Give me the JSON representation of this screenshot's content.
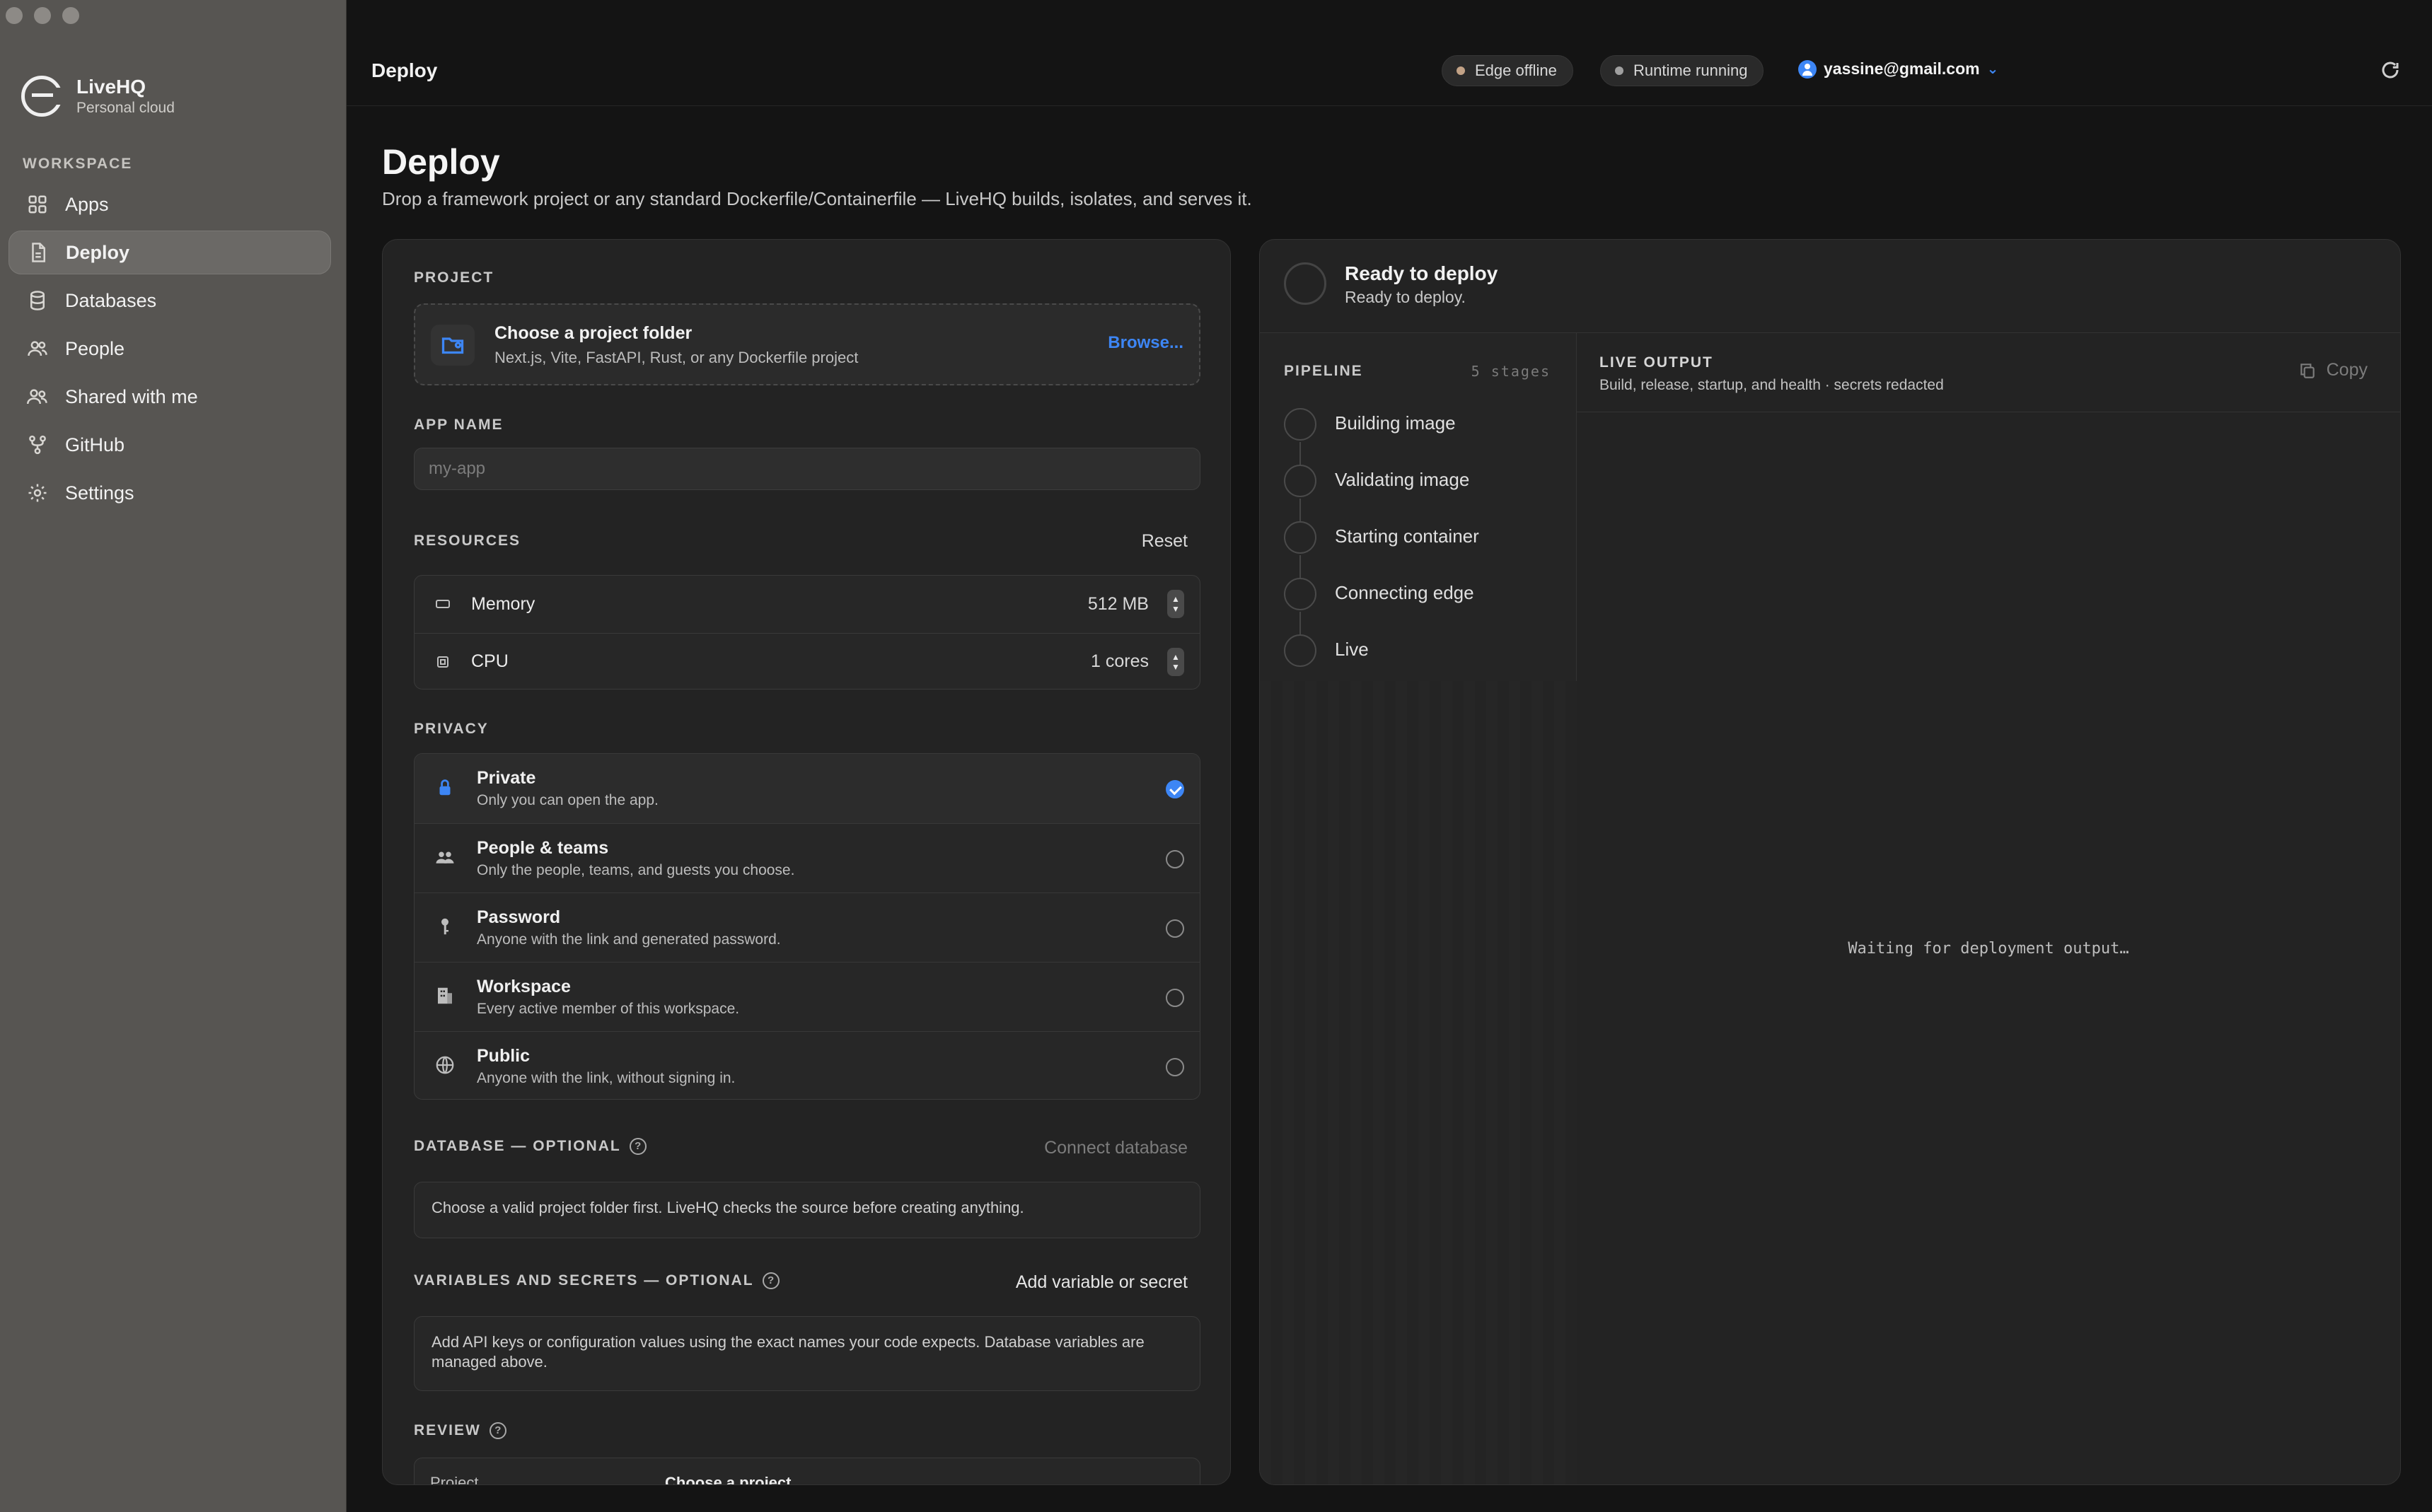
{
  "app": {
    "name": "LiveHQ",
    "subtitle": "Personal cloud"
  },
  "sidebar": {
    "section_label": "WORKSPACE",
    "items": [
      {
        "label": "Apps",
        "icon": "grid-icon"
      },
      {
        "label": "Deploy",
        "icon": "document-icon",
        "active": true
      },
      {
        "label": "Databases",
        "icon": "database-icon"
      },
      {
        "label": "People",
        "icon": "people-icon"
      },
      {
        "label": "Shared with me",
        "icon": "shared-icon"
      },
      {
        "label": "GitHub",
        "icon": "branch-icon"
      },
      {
        "label": "Settings",
        "icon": "gear-icon"
      }
    ]
  },
  "topbar": {
    "title": "Deploy",
    "edge_status": "Edge offline",
    "runtime_status": "Runtime running",
    "user_email": "yassine@gmail.com"
  },
  "page": {
    "title": "Deploy",
    "description": "Drop a framework project or any standard Dockerfile/Containerfile — LiveHQ builds, isolates, and serves it."
  },
  "form": {
    "project": {
      "label": "PROJECT",
      "title": "Choose a project folder",
      "subtitle": "Next.js, Vite, FastAPI, Rust, or any Dockerfile project",
      "browse": "Browse..."
    },
    "app_name": {
      "label": "APP NAME",
      "placeholder": "my-app",
      "value": ""
    },
    "resources": {
      "label": "RESOURCES",
      "reset": "Reset",
      "memory_label": "Memory",
      "memory_value": "512 MB",
      "cpu_label": "CPU",
      "cpu_value": "1 cores"
    },
    "privacy": {
      "label": "PRIVACY",
      "selected": "Private",
      "options": [
        {
          "title": "Private",
          "desc": "Only you can open the app.",
          "icon": "lock-icon"
        },
        {
          "title": "People & teams",
          "desc": "Only the people, teams, and guests you choose.",
          "icon": "people-icon"
        },
        {
          "title": "Password",
          "desc": "Anyone with the link and generated password.",
          "icon": "key-icon"
        },
        {
          "title": "Workspace",
          "desc": "Every active member of this workspace.",
          "icon": "building-icon"
        },
        {
          "title": "Public",
          "desc": "Anyone with the link, without signing in.",
          "icon": "globe-icon"
        }
      ]
    },
    "database": {
      "label": "DATABASE — OPTIONAL",
      "action": "Connect database",
      "info": "Choose a valid project folder first. LiveHQ checks the source before creating anything."
    },
    "variables": {
      "label": "VARIABLES AND SECRETS — OPTIONAL",
      "action": "Add variable or secret",
      "info": "Add API keys or configuration values using the exact names your code expects. Database variables are managed above."
    },
    "review": {
      "label": "REVIEW",
      "project_key": "Project",
      "project_value": "Choose a project"
    }
  },
  "status": {
    "title": "Ready to deploy",
    "subtitle": "Ready to deploy.",
    "pipeline": {
      "label": "PIPELINE",
      "count": "5 stages",
      "stages": [
        "Building image",
        "Validating image",
        "Starting container",
        "Connecting edge",
        "Live"
      ]
    },
    "output": {
      "label": "LIVE OUTPUT",
      "subtitle": "Build, release, startup, and health · secrets redacted",
      "copy": "Copy",
      "waiting": "Waiting for deployment output…"
    }
  },
  "colors": {
    "accent": "#3d86f5",
    "sidebar": "#575552",
    "background": "#141414",
    "card": "#232323"
  }
}
